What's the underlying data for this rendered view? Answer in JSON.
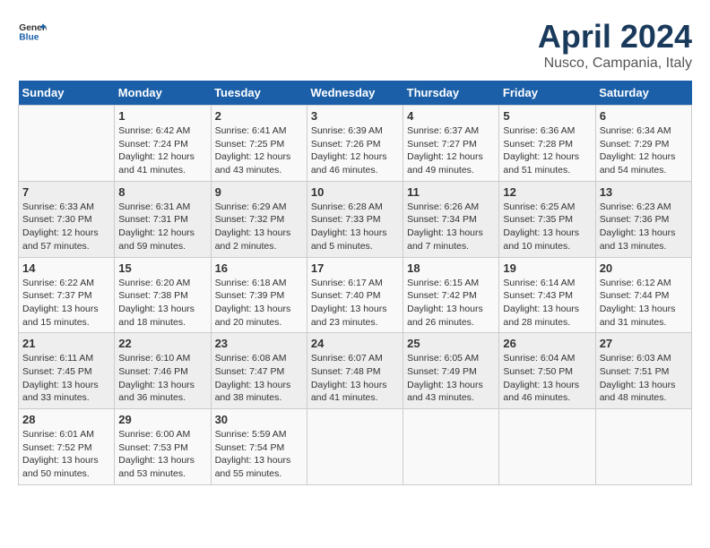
{
  "header": {
    "logo_general": "General",
    "logo_blue": "Blue",
    "title": "April 2024",
    "subtitle": "Nusco, Campania, Italy"
  },
  "calendar": {
    "days_of_week": [
      "Sunday",
      "Monday",
      "Tuesday",
      "Wednesday",
      "Thursday",
      "Friday",
      "Saturday"
    ],
    "weeks": [
      [
        {
          "day": "",
          "sunrise": "",
          "sunset": "",
          "daylight": ""
        },
        {
          "day": "1",
          "sunrise": "Sunrise: 6:42 AM",
          "sunset": "Sunset: 7:24 PM",
          "daylight": "Daylight: 12 hours and 41 minutes."
        },
        {
          "day": "2",
          "sunrise": "Sunrise: 6:41 AM",
          "sunset": "Sunset: 7:25 PM",
          "daylight": "Daylight: 12 hours and 43 minutes."
        },
        {
          "day": "3",
          "sunrise": "Sunrise: 6:39 AM",
          "sunset": "Sunset: 7:26 PM",
          "daylight": "Daylight: 12 hours and 46 minutes."
        },
        {
          "day": "4",
          "sunrise": "Sunrise: 6:37 AM",
          "sunset": "Sunset: 7:27 PM",
          "daylight": "Daylight: 12 hours and 49 minutes."
        },
        {
          "day": "5",
          "sunrise": "Sunrise: 6:36 AM",
          "sunset": "Sunset: 7:28 PM",
          "daylight": "Daylight: 12 hours and 51 minutes."
        },
        {
          "day": "6",
          "sunrise": "Sunrise: 6:34 AM",
          "sunset": "Sunset: 7:29 PM",
          "daylight": "Daylight: 12 hours and 54 minutes."
        }
      ],
      [
        {
          "day": "7",
          "sunrise": "Sunrise: 6:33 AM",
          "sunset": "Sunset: 7:30 PM",
          "daylight": "Daylight: 12 hours and 57 minutes."
        },
        {
          "day": "8",
          "sunrise": "Sunrise: 6:31 AM",
          "sunset": "Sunset: 7:31 PM",
          "daylight": "Daylight: 12 hours and 59 minutes."
        },
        {
          "day": "9",
          "sunrise": "Sunrise: 6:29 AM",
          "sunset": "Sunset: 7:32 PM",
          "daylight": "Daylight: 13 hours and 2 minutes."
        },
        {
          "day": "10",
          "sunrise": "Sunrise: 6:28 AM",
          "sunset": "Sunset: 7:33 PM",
          "daylight": "Daylight: 13 hours and 5 minutes."
        },
        {
          "day": "11",
          "sunrise": "Sunrise: 6:26 AM",
          "sunset": "Sunset: 7:34 PM",
          "daylight": "Daylight: 13 hours and 7 minutes."
        },
        {
          "day": "12",
          "sunrise": "Sunrise: 6:25 AM",
          "sunset": "Sunset: 7:35 PM",
          "daylight": "Daylight: 13 hours and 10 minutes."
        },
        {
          "day": "13",
          "sunrise": "Sunrise: 6:23 AM",
          "sunset": "Sunset: 7:36 PM",
          "daylight": "Daylight: 13 hours and 13 minutes."
        }
      ],
      [
        {
          "day": "14",
          "sunrise": "Sunrise: 6:22 AM",
          "sunset": "Sunset: 7:37 PM",
          "daylight": "Daylight: 13 hours and 15 minutes."
        },
        {
          "day": "15",
          "sunrise": "Sunrise: 6:20 AM",
          "sunset": "Sunset: 7:38 PM",
          "daylight": "Daylight: 13 hours and 18 minutes."
        },
        {
          "day": "16",
          "sunrise": "Sunrise: 6:18 AM",
          "sunset": "Sunset: 7:39 PM",
          "daylight": "Daylight: 13 hours and 20 minutes."
        },
        {
          "day": "17",
          "sunrise": "Sunrise: 6:17 AM",
          "sunset": "Sunset: 7:40 PM",
          "daylight": "Daylight: 13 hours and 23 minutes."
        },
        {
          "day": "18",
          "sunrise": "Sunrise: 6:15 AM",
          "sunset": "Sunset: 7:42 PM",
          "daylight": "Daylight: 13 hours and 26 minutes."
        },
        {
          "day": "19",
          "sunrise": "Sunrise: 6:14 AM",
          "sunset": "Sunset: 7:43 PM",
          "daylight": "Daylight: 13 hours and 28 minutes."
        },
        {
          "day": "20",
          "sunrise": "Sunrise: 6:12 AM",
          "sunset": "Sunset: 7:44 PM",
          "daylight": "Daylight: 13 hours and 31 minutes."
        }
      ],
      [
        {
          "day": "21",
          "sunrise": "Sunrise: 6:11 AM",
          "sunset": "Sunset: 7:45 PM",
          "daylight": "Daylight: 13 hours and 33 minutes."
        },
        {
          "day": "22",
          "sunrise": "Sunrise: 6:10 AM",
          "sunset": "Sunset: 7:46 PM",
          "daylight": "Daylight: 13 hours and 36 minutes."
        },
        {
          "day": "23",
          "sunrise": "Sunrise: 6:08 AM",
          "sunset": "Sunset: 7:47 PM",
          "daylight": "Daylight: 13 hours and 38 minutes."
        },
        {
          "day": "24",
          "sunrise": "Sunrise: 6:07 AM",
          "sunset": "Sunset: 7:48 PM",
          "daylight": "Daylight: 13 hours and 41 minutes."
        },
        {
          "day": "25",
          "sunrise": "Sunrise: 6:05 AM",
          "sunset": "Sunset: 7:49 PM",
          "daylight": "Daylight: 13 hours and 43 minutes."
        },
        {
          "day": "26",
          "sunrise": "Sunrise: 6:04 AM",
          "sunset": "Sunset: 7:50 PM",
          "daylight": "Daylight: 13 hours and 46 minutes."
        },
        {
          "day": "27",
          "sunrise": "Sunrise: 6:03 AM",
          "sunset": "Sunset: 7:51 PM",
          "daylight": "Daylight: 13 hours and 48 minutes."
        }
      ],
      [
        {
          "day": "28",
          "sunrise": "Sunrise: 6:01 AM",
          "sunset": "Sunset: 7:52 PM",
          "daylight": "Daylight: 13 hours and 50 minutes."
        },
        {
          "day": "29",
          "sunrise": "Sunrise: 6:00 AM",
          "sunset": "Sunset: 7:53 PM",
          "daylight": "Daylight: 13 hours and 53 minutes."
        },
        {
          "day": "30",
          "sunrise": "Sunrise: 5:59 AM",
          "sunset": "Sunset: 7:54 PM",
          "daylight": "Daylight: 13 hours and 55 minutes."
        },
        {
          "day": "",
          "sunrise": "",
          "sunset": "",
          "daylight": ""
        },
        {
          "day": "",
          "sunrise": "",
          "sunset": "",
          "daylight": ""
        },
        {
          "day": "",
          "sunrise": "",
          "sunset": "",
          "daylight": ""
        },
        {
          "day": "",
          "sunrise": "",
          "sunset": "",
          "daylight": ""
        }
      ]
    ]
  }
}
